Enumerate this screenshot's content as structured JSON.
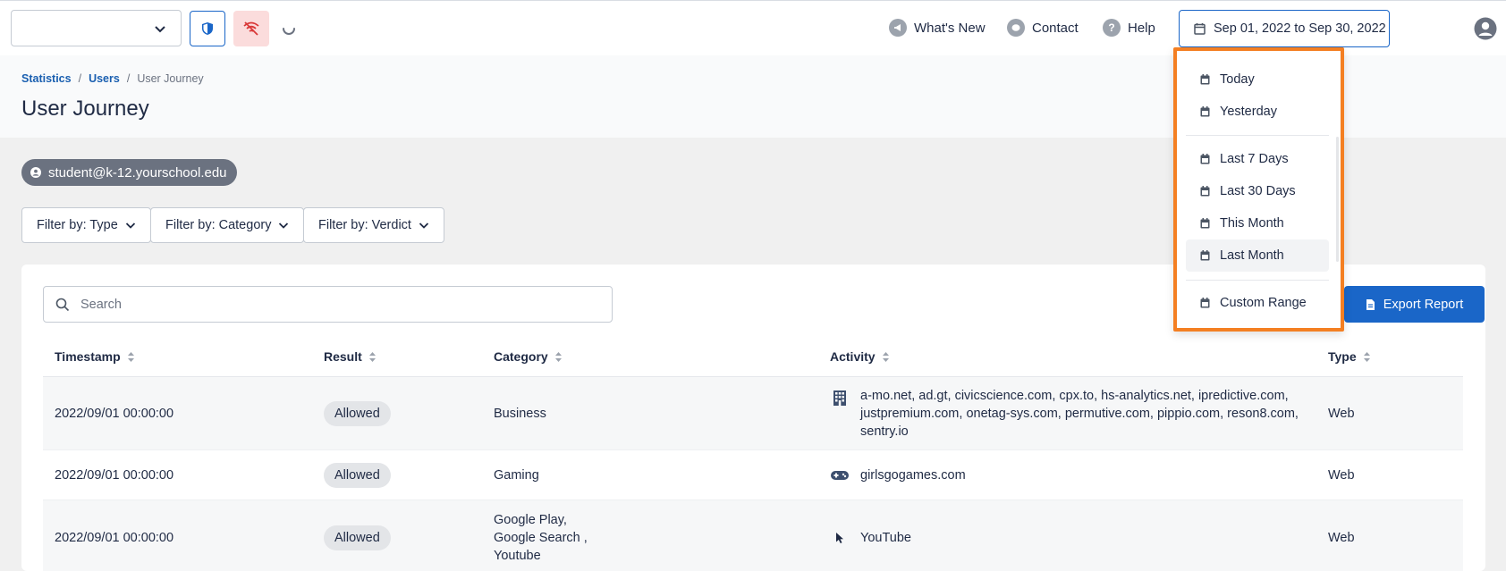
{
  "topbar": {
    "org_select_value": "",
    "nav": {
      "whats_new": "What's New",
      "contact": "Contact",
      "help": "Help"
    },
    "date_range": "Sep 01, 2022 to Sep 30, 2022"
  },
  "breadcrumb": {
    "statistics": "Statistics",
    "users": "Users",
    "current": "User Journey",
    "separator": "/"
  },
  "page_title": "User Journey",
  "user_email": "student@k-12.yourschool.edu",
  "filters": {
    "type": "Filter by: Type",
    "category": "Filter by: Category",
    "verdict": "Filter by: Verdict"
  },
  "search": {
    "placeholder": "Search",
    "value": ""
  },
  "export_label": "Export Report",
  "table": {
    "headers": [
      "Timestamp",
      "Result",
      "Category",
      "Activity",
      "Type"
    ],
    "rows": [
      {
        "timestamp": "2022/09/01 00:00:00",
        "result": "Allowed",
        "category": "Business",
        "activity_icon": "building-icon",
        "activity": [
          "a-mo.net, ad.gt, civicscience.com, cpx.to, hs-analytics.net, ipredictive.com,",
          "justpremium.com, onetag-sys.com, permutive.com, pippio.com, reson8.com,",
          "sentry.io"
        ],
        "type": "Web"
      },
      {
        "timestamp": "2022/09/01 00:00:00",
        "result": "Allowed",
        "category": "Gaming",
        "activity_icon": "gamepad-icon",
        "activity": [
          "girlsgogames.com"
        ],
        "type": "Web"
      },
      {
        "timestamp": "2022/09/01 00:00:00",
        "result": "Allowed",
        "category_lines": [
          "Google Play,",
          "Google Search ,",
          "Youtube"
        ],
        "activity_icon": "cursor-icon",
        "activity": [
          "YouTube"
        ],
        "type": "Web"
      }
    ]
  },
  "date_dropdown": {
    "items": [
      "Today",
      "Yesterday",
      "Last 7 Days",
      "Last 30 Days",
      "This Month",
      "Last Month",
      "Custom Range"
    ],
    "active": "Last Month"
  },
  "colors": {
    "primary": "#1a66c8",
    "highlight_border": "#f47f22",
    "badge_bg": "#e3e5e8",
    "user_pill_bg": "#6b7280"
  }
}
